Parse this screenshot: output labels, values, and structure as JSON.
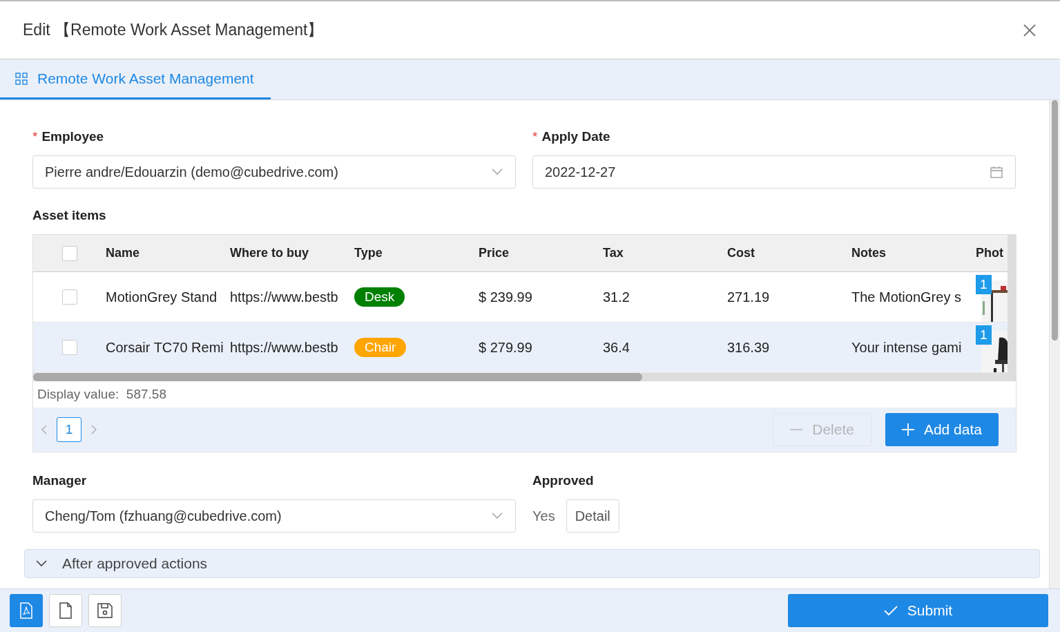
{
  "window": {
    "title": "Edit 【Remote Work Asset Management】"
  },
  "tabs": [
    {
      "label": "Remote Work Asset Management",
      "selected": true
    }
  ],
  "form": {
    "employee": {
      "label": "Employee",
      "required_mark": "*",
      "value": "Pierre andre/Edouarzin (demo@cubedrive.com)"
    },
    "apply_date": {
      "label": "Apply Date",
      "required_mark": "*",
      "value": "2022-12-27"
    },
    "asset_items": {
      "label": "Asset items",
      "columns": [
        "Name",
        "Where to buy",
        "Type",
        "Price",
        "Tax",
        "Cost",
        "Notes",
        "Phot"
      ],
      "header_checked": false,
      "rows": [
        {
          "checked": false,
          "highlighted": false,
          "name": "MotionGrey Stand",
          "where_to_buy": "https://www.bestb",
          "type": {
            "label": "Desk",
            "color": "#008000"
          },
          "price": "$ 239.99",
          "tax": "31.2",
          "cost": "271.19",
          "notes": "The MotionGrey s",
          "photo_count": "1"
        },
        {
          "checked": false,
          "highlighted": true,
          "name": "Corsair TC70 Remi",
          "where_to_buy": "https://www.bestb",
          "type": {
            "label": "Chair",
            "color": "#ffa500"
          },
          "price": "$ 279.99",
          "tax": "36.4",
          "cost": "316.39",
          "notes": "Your intense gami",
          "photo_count": "1"
        }
      ],
      "display_label": "Display value:",
      "display_value": "587.58",
      "pages": [
        {
          "label": "1",
          "selected": true
        }
      ],
      "delete_button": {
        "label": "Delete",
        "disabled": true
      },
      "add_button": {
        "label": "Add data",
        "disabled": false
      }
    },
    "manager": {
      "label": "Manager",
      "value": "Cheng/Tom (fzhuang@cubedrive.com)"
    },
    "approved": {
      "label": "Approved",
      "value": "Yes",
      "button": "Detail"
    },
    "section": {
      "label": "After approved actions",
      "expanded": true
    }
  },
  "footer": {
    "tools": [
      {
        "kind": "pdf",
        "selected": true
      },
      {
        "kind": "file",
        "selected": false
      },
      {
        "kind": "save",
        "selected": false
      }
    ],
    "submit": "Submit"
  }
}
